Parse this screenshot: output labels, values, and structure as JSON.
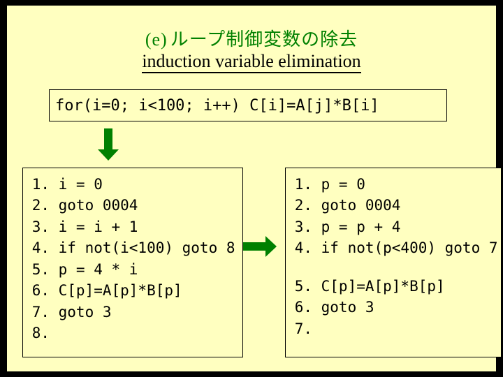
{
  "title": {
    "tag": "(e)",
    "main_ja": "ループ制御変数の除去",
    "sub_en": "induction variable elimination"
  },
  "colors": {
    "accent": "#008000",
    "panel_bg": "#ffffc0"
  },
  "source_code": "for(i=0; i<100; i++) C[i]=A[j]*B[i]",
  "left_panel": [
    {
      "n": "1.",
      "code": "i = 0"
    },
    {
      "n": "2.",
      "code": "goto 0004"
    },
    {
      "n": "3.",
      "code": "i = i + 1"
    },
    {
      "n": "4.",
      "code": "if not(i<100) goto 8"
    },
    {
      "n": "5.",
      "code": "p = 4 * i"
    },
    {
      "n": "6.",
      "code": "C[p]=A[p]*B[p]"
    },
    {
      "n": "7.",
      "code": "goto 3"
    },
    {
      "n": "8.",
      "code": ""
    }
  ],
  "right_panel_top": [
    {
      "n": "1.",
      "code": "p = 0"
    },
    {
      "n": "2.",
      "code": "goto 0004"
    },
    {
      "n": "3.",
      "code": "p = p + 4"
    },
    {
      "n": "4.",
      "code": "if not(p<400) goto 7"
    }
  ],
  "right_panel_bottom": [
    {
      "n": "5.",
      "code": "C[p]=A[p]*B[p]"
    },
    {
      "n": "6.",
      "code": "goto 3"
    },
    {
      "n": "7.",
      "code": ""
    }
  ]
}
